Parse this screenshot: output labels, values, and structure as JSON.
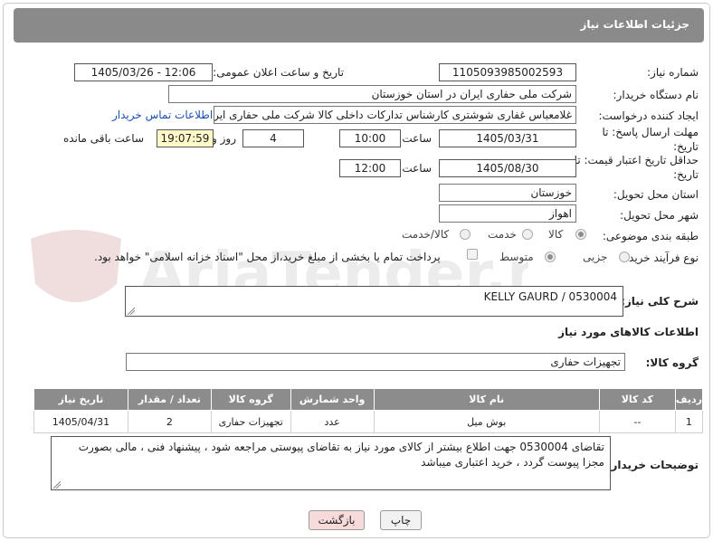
{
  "header": {
    "title": "جزئیات اطلاعات نیاز"
  },
  "form": {
    "need_number_label": "شماره نیاز:",
    "need_number": "1105093985002593",
    "announce_label": "تاریخ و ساعت اعلان عمومی:",
    "announce_value": "1405/03/26 - 12:06",
    "buyer_org_label": "نام دستگاه خریدار:",
    "buyer_org": "شرکت ملی حفاری ایران در استان خوزستان",
    "creator_label": "ایجاد کننده درخواست:",
    "creator": "غلامعباس غفاری شوشتری کارشناس تدارکات داخلی کالا شرکت ملی حفاری ایران",
    "contact_link": "اطلاعات تماس خریدار",
    "deadline_label": "مهلت ارسال پاسخ: تا تاریخ:",
    "deadline_date": "1405/03/31",
    "time_word": "ساعت",
    "deadline_time": "10:00",
    "days_value": "4",
    "days_and": "روز و",
    "remaining_time": "19:07:59",
    "remaining_label": "ساعت باقی مانده",
    "validity_label": "حداقل تاریخ اعتبار قیمت: تا تاریخ:",
    "validity_date": "1405/08/30",
    "validity_time": "12:00",
    "province_label": "استان محل تحویل:",
    "province": "خوزستان",
    "city_label": "شهر محل تحویل:",
    "city": "اهواز",
    "category_label": "طبقه بندی موضوعی:",
    "category_options": [
      "کالا",
      "خدمت",
      "کالا/خدمت"
    ],
    "category_selected": "کالا",
    "process_label": "نوع فرآیند خرید :",
    "process_options": [
      "جزیی",
      "متوسط"
    ],
    "process_selected": "متوسط",
    "payment_note": "پرداخت تمام یا بخشی از مبلغ خرید،از محل \"اسناد خزانه اسلامی\" خواهد بود."
  },
  "description": {
    "label": "شرح کلی نیاز:",
    "value": "KELLY GAURD /  0530004"
  },
  "goods": {
    "section_title": "اطلاعات کالاهای مورد نیاز",
    "group_label": "گروه کالا:",
    "group_value": "تجهیزات حفاری",
    "columns": [
      "ردیف",
      "کد کالا",
      "نام کالا",
      "واحد شمارش",
      "گروه کالا",
      "تعداد / مقدار",
      "تاریخ نیاز"
    ],
    "rows": [
      [
        "1",
        "--",
        "بوش میل",
        "عدد",
        "تجهیزات حفاری",
        "2",
        "1405/04/31"
      ]
    ]
  },
  "buyer_notes": {
    "label": "توضیحات خریدار:",
    "value": "تقاضای 0530004 جهت اطلاع بیشتر از کالای مورد نیاز به تقاضای پیوستی مراجعه شود ، پیشنهاد فنی ، مالی بصورت مجزا پیوست گردد ، خرید اعتباری میباشد"
  },
  "buttons": {
    "print": "چاپ",
    "back": "بازگشت"
  },
  "watermark": {
    "text": "AriaTender.net"
  },
  "colors": {
    "header_bg": "#8a8a8a",
    "table_header_bg": "#8c8c8c",
    "link": "#1a4fb3",
    "back_button_bg": "#f7dada",
    "remaining_bg": "#fffac8"
  }
}
